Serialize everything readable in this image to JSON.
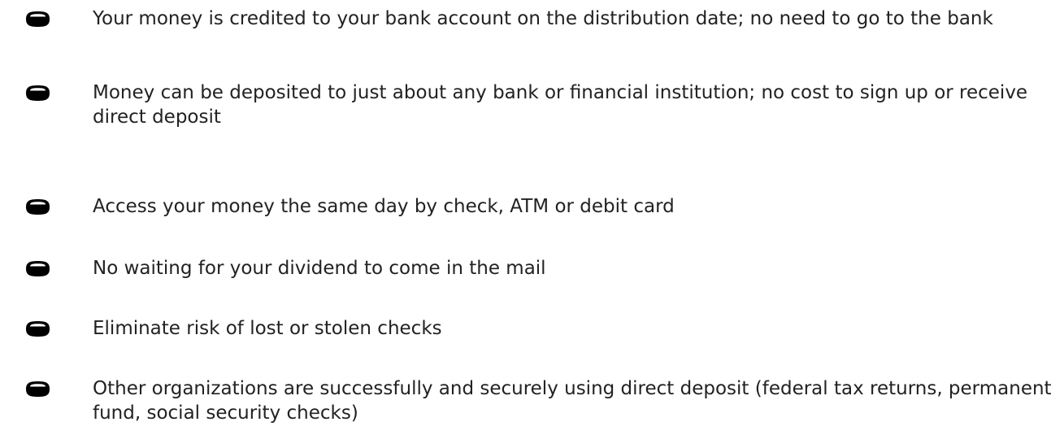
{
  "benefits": {
    "items": [
      {
        "icon": "lozenge-bullet-icon",
        "text": "Your money is credited to your bank account on the distribution date; no need to go to the bank"
      },
      {
        "icon": "lozenge-bullet-icon",
        "text": "Money can be deposited to just about any bank or financial institution; no cost to sign up or receive direct deposit"
      },
      {
        "icon": "lozenge-bullet-icon",
        "text": "Access your money the same day by check, ATM or debit card"
      },
      {
        "icon": "lozenge-bullet-icon",
        "text": "No waiting for your dividend to come in the mail"
      },
      {
        "icon": "lozenge-bullet-icon",
        "text": "Eliminate risk of lost or stolen checks"
      },
      {
        "icon": "lozenge-bullet-icon",
        "text": "Other organizations are successfully and securely using direct deposit (federal tax returns, permanent fund, social security checks)"
      }
    ]
  },
  "colors": {
    "text": "#222222",
    "bullet": "#000000",
    "background": "#ffffff"
  }
}
